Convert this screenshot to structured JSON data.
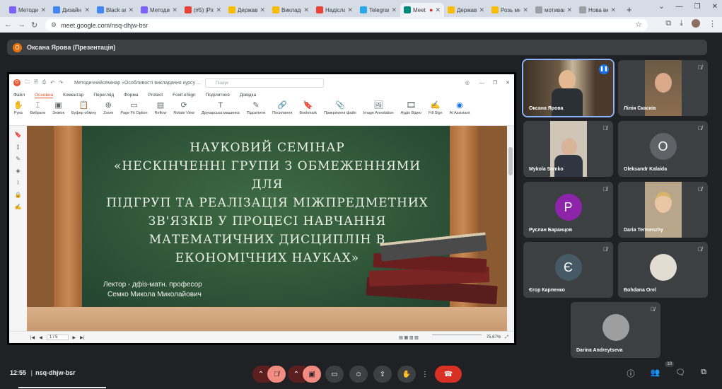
{
  "browser": {
    "tabs": [
      {
        "title": "Методи",
        "color": "#7b61ff"
      },
      {
        "title": "Дизайн",
        "color": "#4285f4"
      },
      {
        "title": "Black an",
        "color": "#4285f4"
      },
      {
        "title": "Методи",
        "color": "#7b61ff"
      },
      {
        "title": "(#5) |Pio",
        "color": "#ea4335"
      },
      {
        "title": "Держав",
        "color": "#fbbc04"
      },
      {
        "title": "Викладе",
        "color": "#fbbc04"
      },
      {
        "title": "Надісла",
        "color": "#ea4335"
      },
      {
        "title": "Telegram",
        "color": "#29a9eb"
      },
      {
        "title": "Meet",
        "color": "#00897b",
        "active": true
      },
      {
        "title": "Держав",
        "color": "#fbbc04"
      },
      {
        "title": "Розь мн",
        "color": "#fbbc04"
      },
      {
        "title": "мотивац",
        "color": "#9aa0a6"
      },
      {
        "title": "Нова вк",
        "color": "#9aa0a6"
      }
    ],
    "new_tab": "+",
    "url": "meet.google.com/nsq-dhjw-bsr"
  },
  "meet": {
    "presenter_initial": "О",
    "presenter_label": "Оксана Ярова (Презентація)",
    "meeting_time": "12:55",
    "meeting_code": "nsq-dhjw-bsr",
    "participant_count": "10"
  },
  "foxit": {
    "doc_title": "Методичнийсемінар «Особливості викладання курсу ...",
    "search_placeholder": "Пошук",
    "menu": [
      "Файл",
      "Основна",
      "Коментар",
      "Перегляд",
      "Форма",
      "Protect",
      "Foxit eSign",
      "Поділитися",
      "Довідка"
    ],
    "tools": [
      {
        "label": "Рука",
        "icon": "✋"
      },
      {
        "label": "Вибрати",
        "icon": "⌶"
      },
      {
        "label": "Знімок",
        "icon": "▣"
      },
      {
        "label": "Буфер обміну",
        "icon": "📋"
      },
      {
        "label": "Zoom",
        "icon": "⊕"
      },
      {
        "label": "Page Fit Option",
        "icon": "▭"
      },
      {
        "label": "Reflow",
        "icon": "▤"
      },
      {
        "label": "Rotate View",
        "icon": "⟳"
      },
      {
        "label": "Друкарська машинка",
        "icon": "T"
      },
      {
        "label": "Підсвітити",
        "icon": "✎"
      },
      {
        "label": "Посилання",
        "icon": "🔗"
      },
      {
        "label": "Bookmark",
        "icon": "🔖"
      },
      {
        "label": "Прикріплені файл",
        "icon": "📎"
      },
      {
        "label": "Image Annotation",
        "icon": "🖼"
      },
      {
        "label": "Аудіо Відео",
        "icon": "🎞"
      },
      {
        "label": "Fill Sign",
        "icon": "✍"
      },
      {
        "label": "AI Assistant",
        "icon": "◉"
      }
    ],
    "page": "1 / 5",
    "zoom": "75.67%"
  },
  "slide": {
    "title_lines": [
      "НАУКОВИЙ СЕМІНАР",
      "«НЕСКІНЧЕННІ ГРУПИ З ОБМЕЖЕННЯМИ ДЛЯ",
      "ПІДГРУП ТА РЕАЛІЗАЦІЯ МІЖПРЕДМЕТНИХ",
      "ЗВ'ЯЗКІВ У ПРОЦЕСІ НАВЧАННЯ",
      "МАТЕМАТИЧНИХ ДИСЦИПЛІН В",
      "ЕКОНОМІЧНИХ НАУКАХ»"
    ],
    "lecturer_line1": "Лектор - дфіз-матн. професор",
    "lecturer_line2": "Семко Микола Миколайович"
  },
  "participants": [
    {
      "name": "Оксана Ярова",
      "type": "photo",
      "speaking": true,
      "bg": "#5b4a3a"
    },
    {
      "name": "Лілія Скасків",
      "type": "photo",
      "bg": "#8c6d4f"
    },
    {
      "name": "Mykola Semko",
      "type": "photo",
      "bg": "#cfc6b8"
    },
    {
      "name": "Oleksandr Kalaida",
      "type": "initial",
      "initial": "O",
      "color": "#5f6368"
    },
    {
      "name": "Руслан Баранцов",
      "type": "initial",
      "initial": "Р",
      "color": "#8e24aa"
    },
    {
      "name": "Daria Termenzhy",
      "type": "photo",
      "bg": "#b9a58a"
    },
    {
      "name": "Єгор Карпенко",
      "type": "initial",
      "initial": "Є",
      "color": "#455a64"
    },
    {
      "name": "Bohdana Orel",
      "type": "avatar",
      "bg": "#e3dcd2"
    },
    {
      "name": "Darina Andreytseva",
      "type": "avatar",
      "bg": "#9e9e9e"
    }
  ],
  "colors": {
    "end_call": "#d93025",
    "muted": "#f28b82"
  }
}
